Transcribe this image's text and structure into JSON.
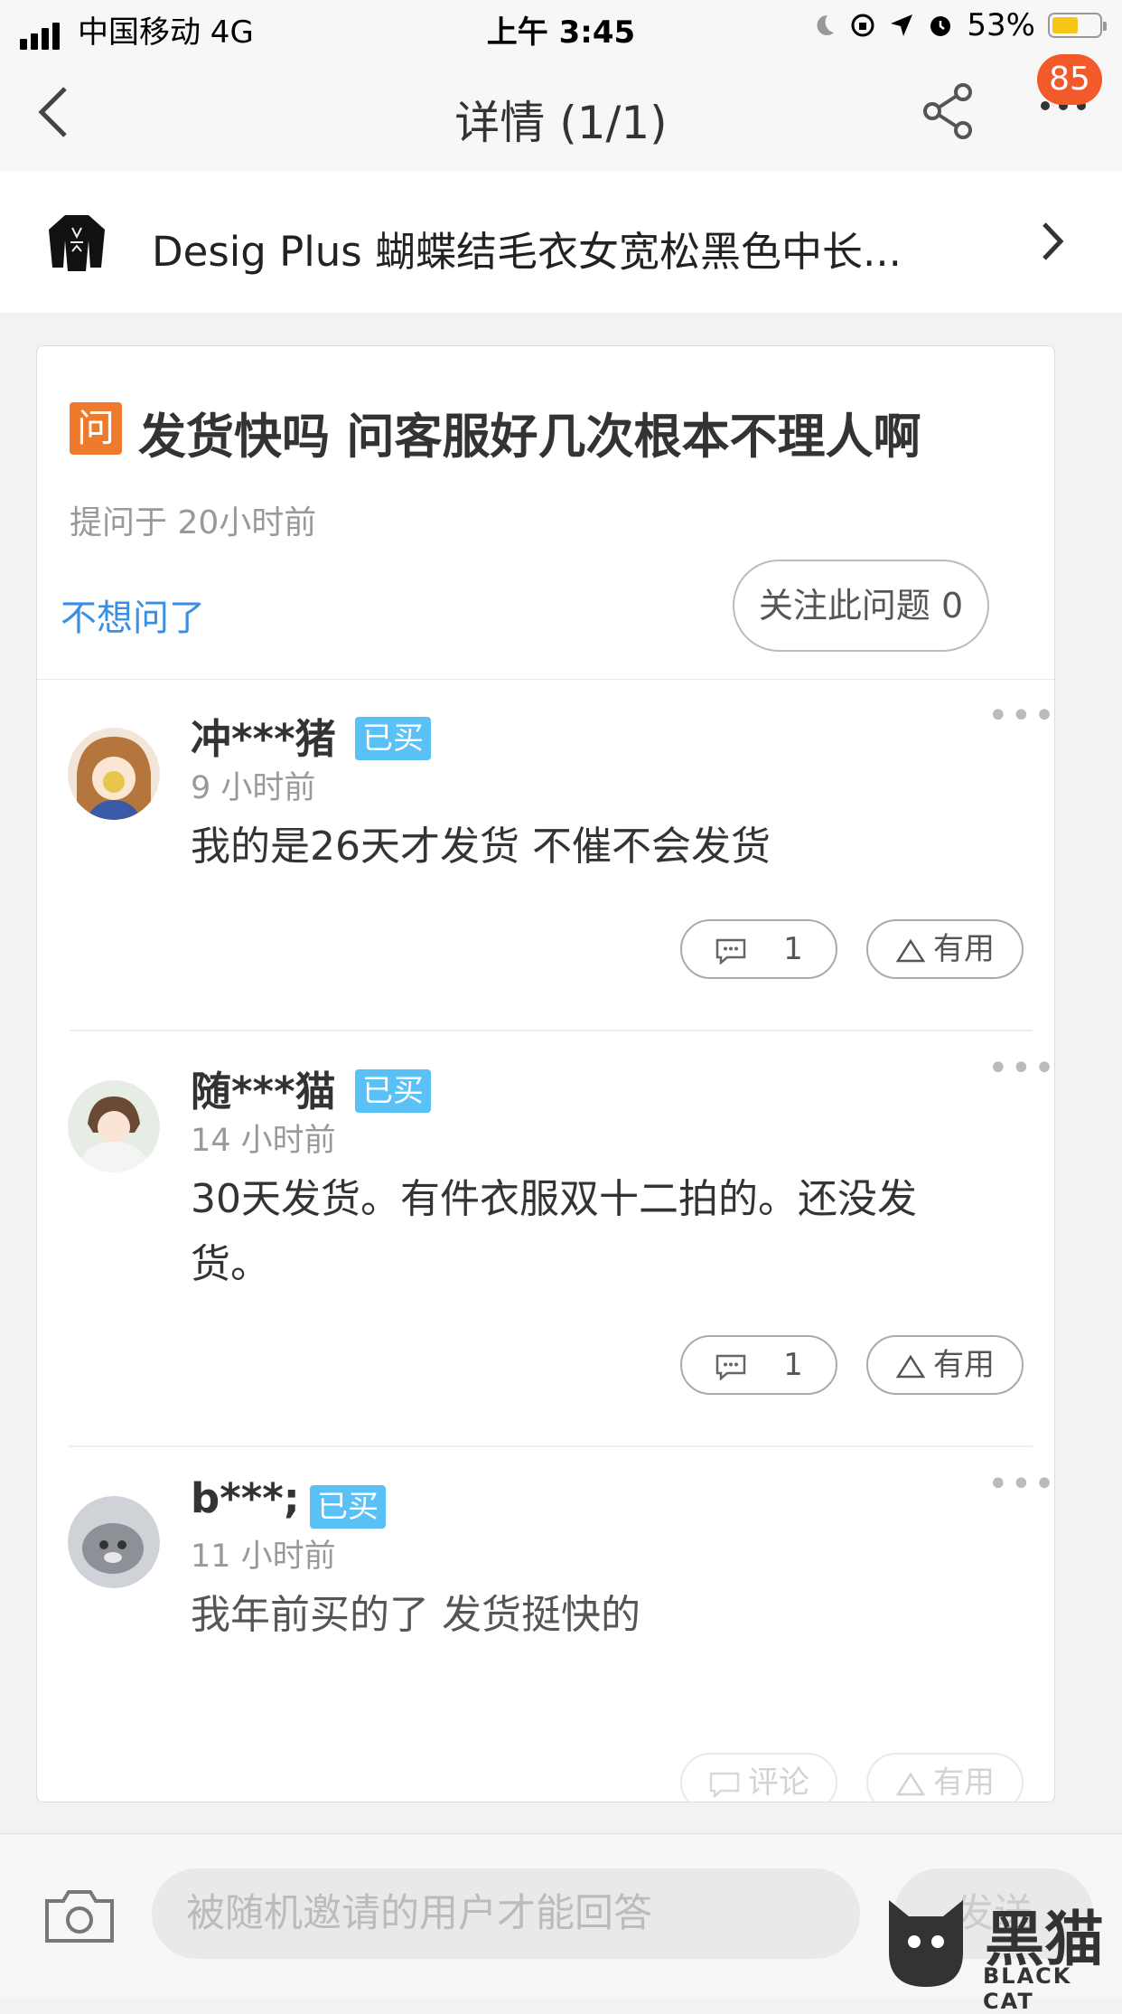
{
  "status_bar": {
    "carrier": "中国移动  4G",
    "time": "上午 3:45",
    "battery": "53%",
    "battery_level": 0.53
  },
  "nav": {
    "title": "详情 (1/1)",
    "badge": "85"
  },
  "product": {
    "name": "Desig Plus 蝴蝶结毛衣女宽松黑色中长..."
  },
  "question": {
    "badge": "问",
    "title": "发货快吗 问客服好几次根本不理人啊",
    "asked_time": "提问于 20小时前",
    "cancel_label": "不想问了",
    "follow_label": "关注此问题 0"
  },
  "answers": [
    {
      "user": "冲***猪",
      "badge": "已买",
      "time": "9 小时前",
      "text": "我的是26天才发货   不催不会发货",
      "comment_count": "1",
      "useful_label": "有用"
    },
    {
      "user": "随***猫",
      "badge": "已买",
      "time": "14 小时前",
      "text": "30天发货。有件衣服双十二拍的。还没发货。",
      "comment_count": "1",
      "useful_label": "有用"
    },
    {
      "user": "b***;",
      "badge": "已买",
      "time": "11 小时前",
      "text": "我年前买的了 发货挺快的",
      "comment_label": "评论",
      "useful_label": "有用"
    }
  ],
  "bottom_bar": {
    "placeholder": "被随机邀请的用户才能回答",
    "send_label": "发送"
  },
  "watermark": {
    "cn": "黑猫",
    "en": "BLACK CAT"
  }
}
